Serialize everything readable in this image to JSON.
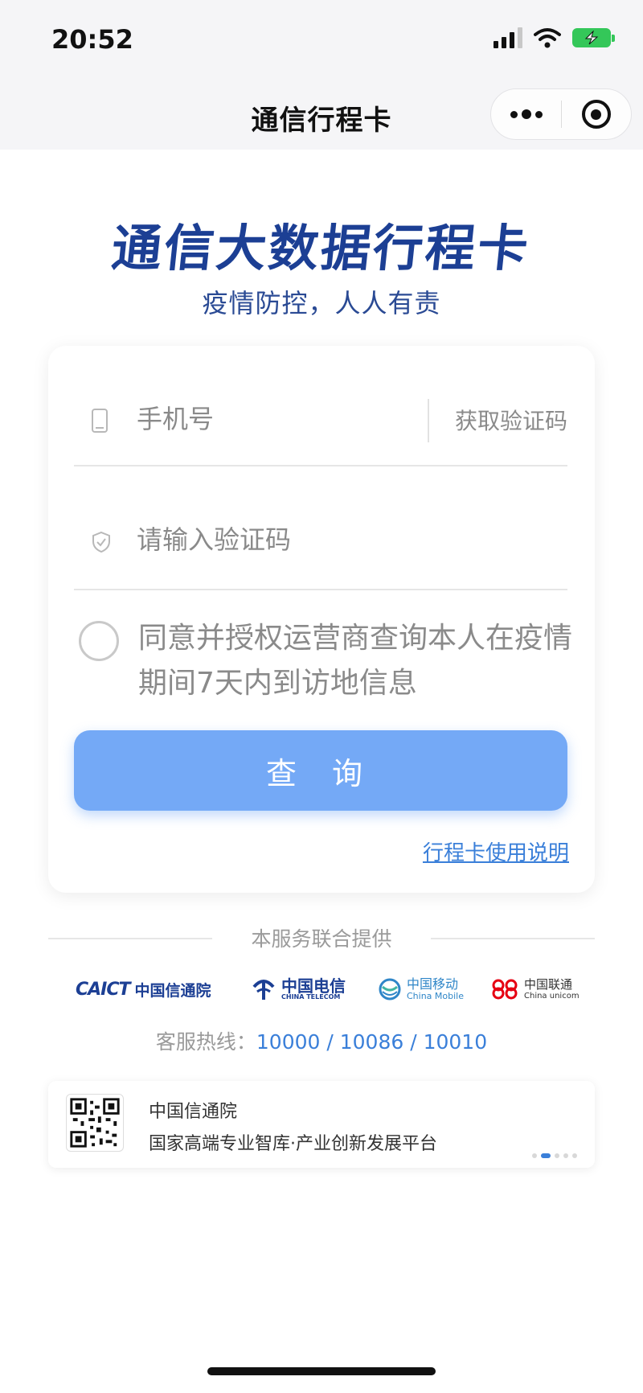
{
  "status_bar": {
    "time": "20:52"
  },
  "nav": {
    "title": "通信行程卡"
  },
  "header": {
    "title": "通信大数据行程卡",
    "subtitle": "疫情防控，人人有责"
  },
  "form": {
    "phone_placeholder": "手机号",
    "get_code_label": "获取验证码",
    "code_placeholder": "请输入验证码",
    "agreement_text": "同意并授权运营商查询本人在疫情期间7天内到访地信息",
    "query_label": "查 询",
    "guide_link": "行程卡使用说明"
  },
  "providers": {
    "title": "本服务联合提供",
    "logos": [
      {
        "mark": "CAICT",
        "name": "中国信通院"
      },
      {
        "name": "中国电信",
        "sub": "CHINA TELECOM"
      },
      {
        "name": "中国移动",
        "sub": "China Mobile"
      },
      {
        "name": "中国联通",
        "sub": "China unicom"
      }
    ],
    "hotline_label": "客服热线：",
    "hotline_numbers": "10000 / 10086 / 10010"
  },
  "banner": {
    "title": "中国信通院",
    "text": "国家高端专业智库·产业创新发展平台"
  },
  "colors": {
    "brand_blue": "#1c3f94",
    "button_blue": "#74a9f6",
    "link_blue": "#3a7fd9",
    "battery_green": "#34c759"
  }
}
